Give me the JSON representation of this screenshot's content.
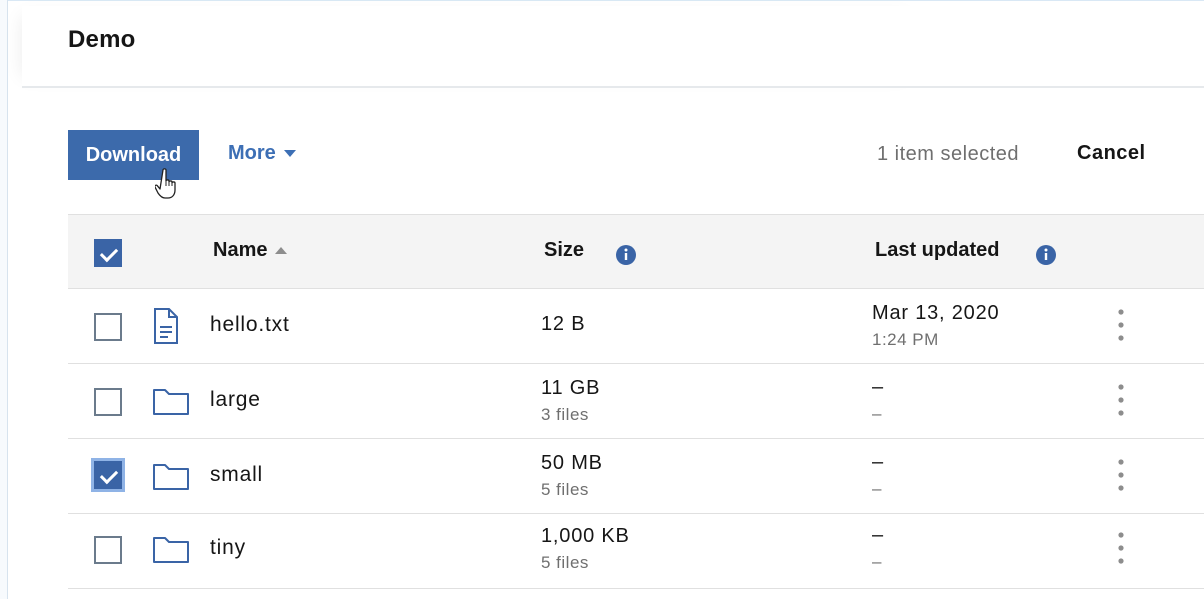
{
  "page": {
    "title": "Demo"
  },
  "toolbar": {
    "download_label": "Download",
    "more_label": "More",
    "selection_status": "1 item selected",
    "cancel_label": "Cancel"
  },
  "table": {
    "columns": {
      "name": "Name",
      "size": "Size",
      "last_updated": "Last updated"
    },
    "header_checked": true,
    "rows": [
      {
        "name": "hello.txt",
        "type": "file",
        "size": "12 B",
        "sub": "",
        "date": "Mar 13, 2020",
        "time": "1:24 PM",
        "checked": false
      },
      {
        "name": "large",
        "type": "folder",
        "size": "11 GB",
        "sub": "3 files",
        "date": "–",
        "time": "–",
        "checked": false
      },
      {
        "name": "small",
        "type": "folder",
        "size": "50 MB",
        "sub": "5 files",
        "date": "–",
        "time": "–",
        "checked": true
      },
      {
        "name": "tiny",
        "type": "folder",
        "size": "1,000 KB",
        "sub": "5 files",
        "date": "–",
        "time": "–",
        "checked": false
      }
    ]
  },
  "colors": {
    "primary": "#3c6aab",
    "link": "#3d6fb5",
    "checkbox_checked": "#3a64a6",
    "muted_text": "#6f6f6f"
  },
  "icons": {
    "file": "document-icon",
    "folder": "folder-icon",
    "info": "info-icon",
    "overflow": "overflow-menu-icon",
    "cursor": "hand-pointer-icon",
    "sort": "sort-ascending-icon"
  }
}
